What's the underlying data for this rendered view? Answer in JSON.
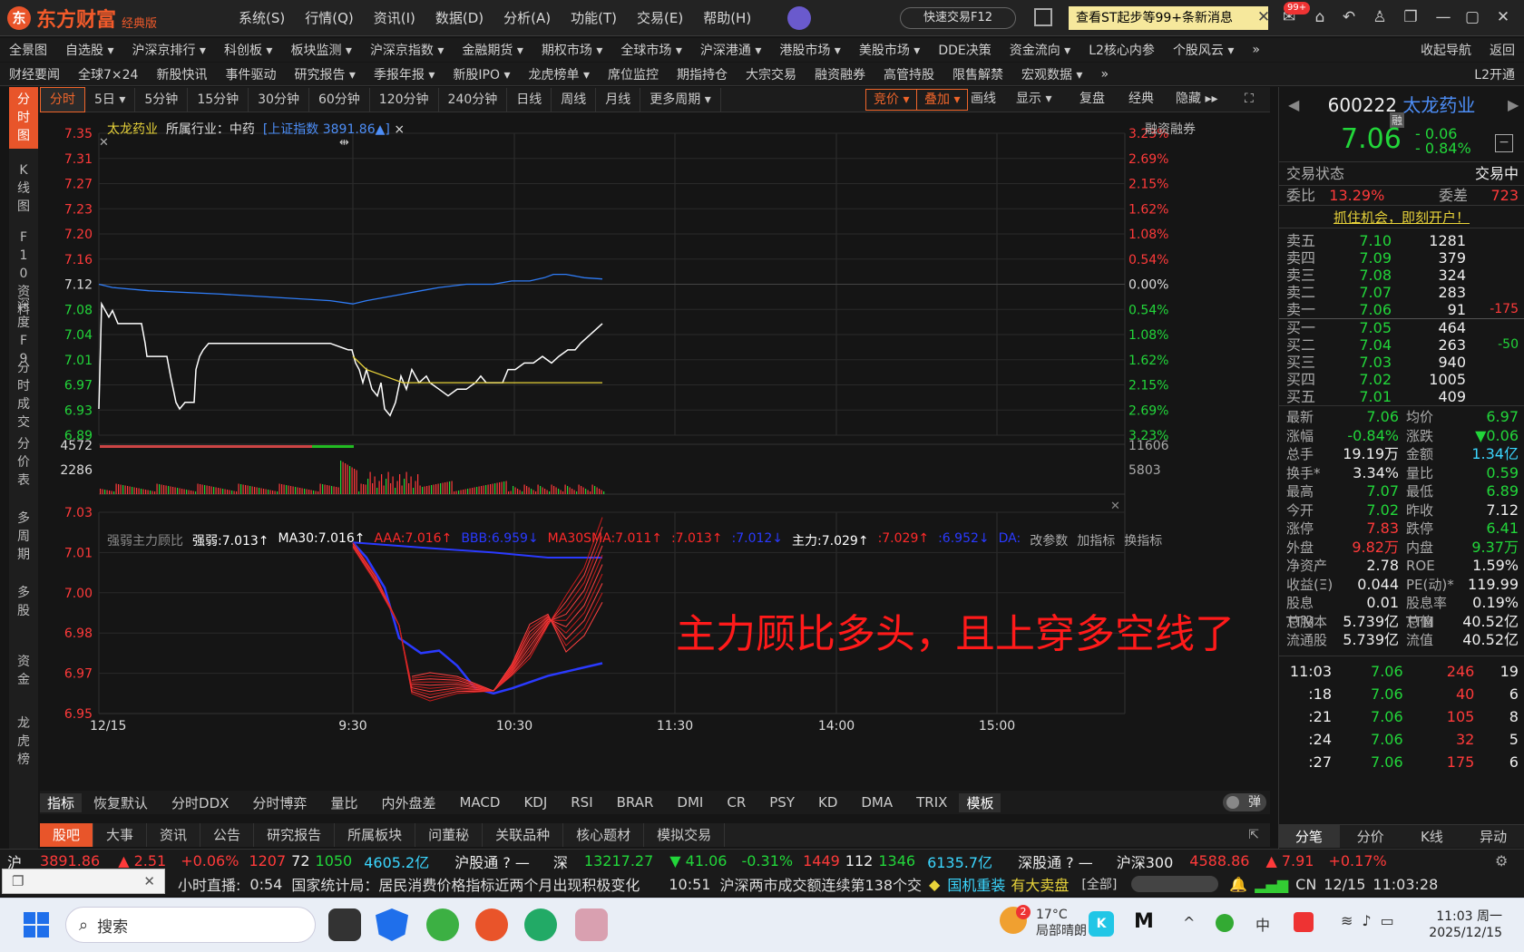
{
  "app": {
    "name": "东方财富",
    "edition": "经典版",
    "logo_icon": "东"
  },
  "menu": [
    "系统(S)",
    "行情(Q)",
    "资讯(I)",
    "数据(D)",
    "分析(A)",
    "功能(T)",
    "交易(E)",
    "帮助(H)"
  ],
  "quick_trade": "快速交易F12",
  "notice": "查看ST起步等99+条新消息",
  "mail_badge": "99+",
  "nav1": [
    "全景图",
    "自选股 ▾",
    "沪深京排行 ▾",
    "科创板 ▾",
    "板块监测 ▾",
    "沪深京指数 ▾",
    "金融期货 ▾",
    "期权市场 ▾",
    "全球市场 ▾",
    "沪深港通 ▾",
    "港股市场 ▾",
    "美股市场 ▾",
    "DDE决策",
    "资金流向 ▾",
    "L2核心内参",
    "个股风云 ▾",
    "»",
    "收起导航",
    "返回"
  ],
  "nav2": [
    "财经要闻",
    "全球7×24",
    "新股快讯",
    "事件驱动",
    "研究报告 ▾",
    "季报年报 ▾",
    "新股IPO ▾",
    "龙虎榜单 ▾",
    "席位监控",
    "期指持仓",
    "大宗交易",
    "融资融券",
    "高管持股",
    "限售解禁",
    "宏观数据 ▾",
    "»",
    "L2开通"
  ],
  "left_strip": [
    "分时图",
    "K线图",
    "F10资料",
    "深度F9",
    "分时成交",
    "分价表",
    "多周期",
    "多股",
    "资金",
    "龙虎榜"
  ],
  "periods": [
    "分时",
    "5日 ▾",
    "5分钟",
    "15分钟",
    "30分钟",
    "60分钟",
    "120分钟",
    "240分钟",
    "日线",
    "周线",
    "月线",
    "更多周期 ▾"
  ],
  "chart_tools": [
    "竞价 ▾",
    "叠加 ▾",
    "画线",
    "显示 ▾",
    "复盘",
    "经典",
    "隐藏 ▸▸"
  ],
  "info": {
    "stock": "太龙药业",
    "industry": "所属行业：中药",
    "index": "[上证指数 3891.86▲]",
    "close_mark": "×",
    "rzrq": "融资融券"
  },
  "price_axis": {
    "left": [
      "7.35",
      "7.31",
      "7.27",
      "7.23",
      "7.20",
      "7.16",
      "7.12",
      "7.08",
      "7.04",
      "7.01",
      "6.97",
      "6.93",
      "6.89"
    ],
    "right": [
      "3.23%",
      "2.69%",
      "2.15%",
      "1.62%",
      "1.08%",
      "0.54%",
      "0.00%",
      "0.54%",
      "1.08%",
      "1.62%",
      "2.15%",
      "2.69%",
      "3.23%"
    ]
  },
  "volume_axis": {
    "left": [
      "4572",
      "2286"
    ],
    "right": [
      "11606",
      "5803"
    ]
  },
  "time_axis": [
    "12/15",
    "9:30",
    "10:30",
    "11:30",
    "14:00",
    "15:00"
  ],
  "indicator_axis": [
    "7.03",
    "7.01",
    "7.00",
    "6.98",
    "6.97",
    "6.95"
  ],
  "indicator_line": [
    {
      "t": "强弱主力顾比",
      "c": "#888888"
    },
    {
      "t": "强弱:7.013↑",
      "c": "#ffffff"
    },
    {
      "t": "MA30:7.016↑",
      "c": "#ffffff"
    },
    {
      "t": "AAA:7.016↑",
      "c": "#ff2a2a"
    },
    {
      "t": "BBB:6.959↓",
      "c": "#2a3aff"
    },
    {
      "t": "MA30SMA:7.011↑",
      "c": "#ff2a2a"
    },
    {
      "t": ":7.013↑",
      "c": "#ff2a2a"
    },
    {
      "t": ":7.012↓",
      "c": "#2a3aff"
    },
    {
      "t": "主力:7.029↑",
      "c": "#ffffff"
    },
    {
      "t": ":7.029↑",
      "c": "#ff2a2a"
    },
    {
      "t": ":6.952↓",
      "c": "#2a3aff"
    },
    {
      "t": "DA:",
      "c": "#2a3aff"
    },
    {
      "t": "改参数",
      "c": "#aaaaaa"
    },
    {
      "t": "加指标",
      "c": "#aaaaaa"
    },
    {
      "t": "换指标",
      "c": "#aaaaaa"
    }
  ],
  "annotation": "主力顾比多头，且上穿多空线了",
  "indicator_tabs": [
    "指标",
    "恢复默认",
    "分时DDX",
    "分时博弈",
    "量比",
    "内外盘差",
    "MACD",
    "KDJ",
    "RSI",
    "BRAR",
    "DMI",
    "CR",
    "PSY",
    "KD",
    "DMA",
    "TRIX",
    "模板"
  ],
  "dan_toggle": "弹",
  "sub_tabs": [
    "股吧",
    "大事",
    "资讯",
    "公告",
    "研究报告",
    "所属板块",
    "问董秘",
    "关联品种",
    "核心题材",
    "模拟交易"
  ],
  "stock": {
    "code": "600222",
    "name": "太龙药业",
    "tag": "融",
    "price": "7.06",
    "change": "- 0.06",
    "pct": "- 0.84%"
  },
  "status": {
    "label": "交易状态",
    "value": "交易中"
  },
  "weibi": {
    "label": "委比",
    "value": "13.29%",
    "label2": "委差",
    "value2": "723"
  },
  "promo": "抓住机会，即刻开户！",
  "asks": [
    {
      "l": "卖五",
      "p": "7.10",
      "v": "1281",
      "d": ""
    },
    {
      "l": "卖四",
      "p": "7.09",
      "v": "379",
      "d": ""
    },
    {
      "l": "卖三",
      "p": "7.08",
      "v": "324",
      "d": ""
    },
    {
      "l": "卖二",
      "p": "7.07",
      "v": "283",
      "d": ""
    },
    {
      "l": "卖一",
      "p": "7.06",
      "v": "91",
      "d": "-175"
    }
  ],
  "bids": [
    {
      "l": "买一",
      "p": "7.05",
      "v": "464",
      "d": ""
    },
    {
      "l": "买二",
      "p": "7.04",
      "v": "263",
      "d": "-50"
    },
    {
      "l": "买三",
      "p": "7.03",
      "v": "940",
      "d": ""
    },
    {
      "l": "买四",
      "p": "7.02",
      "v": "1005",
      "d": ""
    },
    {
      "l": "买五",
      "p": "7.01",
      "v": "409",
      "d": ""
    }
  ],
  "stats": [
    [
      "最新",
      "7.06",
      "g",
      "均价",
      "6.97",
      "g"
    ],
    [
      "涨幅",
      "-0.84%",
      "g",
      "涨跌",
      "▼0.06",
      "g"
    ],
    [
      "总手",
      "19.19万",
      "w",
      "金额",
      "1.34亿",
      "c"
    ],
    [
      "换手*",
      "3.34%",
      "w",
      "量比",
      "0.59",
      "g"
    ],
    [
      "最高",
      "7.07",
      "g",
      "最低",
      "6.89",
      "g"
    ],
    [
      "今开",
      "7.02",
      "g",
      "昨收",
      "7.12",
      "w"
    ],
    [
      "涨停",
      "7.83",
      "r",
      "跌停",
      "6.41",
      "g"
    ],
    [
      "外盘",
      "9.82万",
      "r",
      "内盘",
      "9.37万",
      "g"
    ],
    [
      "净资产",
      "2.78",
      "w",
      "ROE",
      "1.59%",
      "w"
    ],
    [
      "收益(Ξ)",
      "0.044",
      "w",
      "PE(动)*",
      "119.99",
      "w"
    ],
    [
      "股息TTM",
      "0.01",
      "w",
      "股息率TTM",
      "0.19%",
      "w"
    ],
    [
      "总股本",
      "5.739亿",
      "w",
      "总值",
      "40.52亿",
      "w"
    ],
    [
      "流通股",
      "5.739亿",
      "w",
      "流值",
      "40.52亿",
      "w"
    ]
  ],
  "ticks": [
    {
      "t": "11:03",
      "p": "7.06",
      "v": "246",
      "n": "19",
      "c": "r"
    },
    {
      "t": ":18",
      "p": "7.06",
      "v": "40",
      "n": "6",
      "c": "r"
    },
    {
      "t": ":21",
      "p": "7.06",
      "v": "105",
      "n": "8",
      "c": "r"
    },
    {
      "t": ":24",
      "p": "7.06",
      "v": "32",
      "n": "5",
      "c": "r"
    },
    {
      "t": ":27",
      "p": "7.06",
      "v": "175",
      "n": "6",
      "c": "r"
    }
  ],
  "right_tabs": [
    "分笔",
    "分价",
    "K线",
    "异动"
  ],
  "ticker": {
    "sh": {
      "label": "沪",
      "idx": "3891.86",
      "chg": "▲ 2.51",
      "pct": "+0.06%",
      "up": "1207",
      "flat": "72",
      "down": "1050",
      "amt": "4605.2亿"
    },
    "hgt": "沪股通 ? —",
    "sz": {
      "label": "深",
      "idx": "13217.27",
      "chg": "▼ 41.06",
      "pct": "-0.31%",
      "up": "1449",
      "flat": "112",
      "down": "1346",
      "amt": "6135.7亿"
    },
    "sgt": "深股通 ? —",
    "hs300": {
      "label": "沪深300",
      "idx": "4588.86",
      "chg": "▲ 7.91",
      "pct": "+0.17%"
    }
  },
  "news": {
    "prefix": "小时直播:",
    "t1": "0:54",
    "n1": "国家统计局：居民消费价格指标近两个月出现积极变化",
    "t2": "10:51",
    "n2": "沪深两市成交额连续第138个交",
    "hl1": "国机重装",
    "hl2": "有大卖盘",
    "all": "[全部]",
    "net": "CN",
    "date": "12/15",
    "time": "11:03:28"
  },
  "taskbar": {
    "search": "搜索",
    "weather": "17°C",
    "weather_desc": "局部晴朗",
    "weather_badge": "2",
    "clock_time": "11:03 周一",
    "clock_date": "2025/12/15",
    "ime": "中"
  },
  "colors": {
    "accent": "#e8552a",
    "up": "#ff3a3a",
    "down": "#22d63a",
    "price_line": "#ffffff",
    "avg_line": "#e8d33a",
    "index_line": "#2f7cf6"
  }
}
